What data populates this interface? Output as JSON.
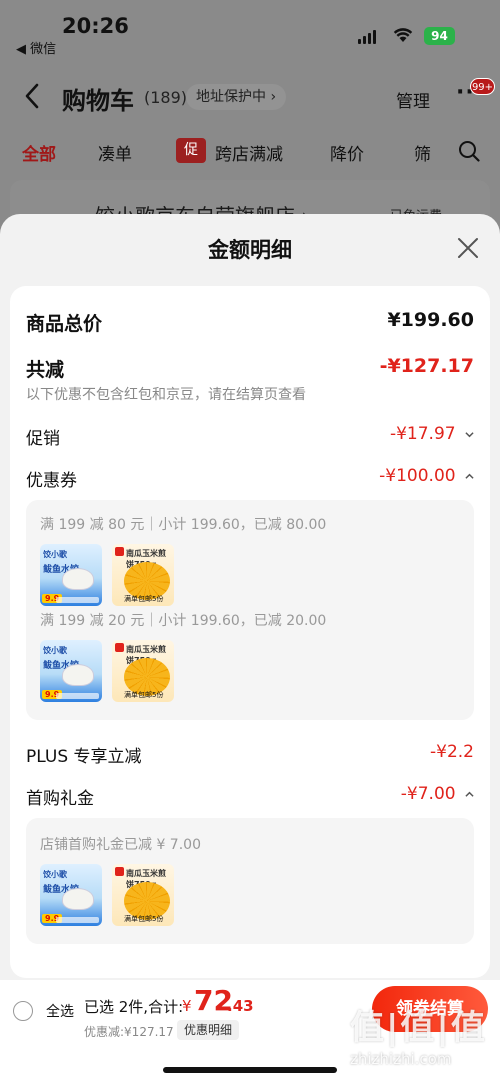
{
  "status": {
    "time": "20:26",
    "back_app": "◀ 微信",
    "battery": "94"
  },
  "nav": {
    "title": "购物车",
    "count": "(189)",
    "address_protect": "地址保护中 ›",
    "manage": "管理",
    "more": "···",
    "badge": "99+"
  },
  "filters": {
    "all": "全部",
    "combine": "凑单",
    "promo_tag": "促",
    "store_discount": "跨店满减",
    "price_drop": "降价",
    "screen": "筛"
  },
  "bg_shop": {
    "name": "饺小歌京东自营旗舰店 ›",
    "fee": "已免运费"
  },
  "sheet": {
    "title": "金额明细",
    "total_label": "商品总价",
    "total_value": "¥199.60",
    "reduce_label": "共减",
    "reduce_value": "-¥127.17",
    "reduce_note": "以下优惠不包含红包和京豆，请在结算页查看",
    "promo_label": "促销",
    "promo_value": "-¥17.97",
    "coupon_label": "优惠券",
    "coupon_value": "-¥100.00",
    "coupon_lines": [
      "满 199 减 80 元｜小计 199.60，已减 80.00",
      "满 199 减 20 元｜小计 199.60，已减 20.00"
    ],
    "plus_label": "PLUS 专享立减",
    "plus_value": "-¥2.2",
    "gift_label": "首购礼金",
    "gift_value": "-¥7.00",
    "gift_line": "店铺首购礼金已减 ¥ 7.00"
  },
  "product_a": {
    "brand": "饺小歌",
    "name": "鲅鱼水饺",
    "tag": "9.9"
  },
  "product_b": {
    "name": "南瓜玉米煎饼750g",
    "foot": "满单包邮5份"
  },
  "bottom": {
    "select_all": "全选",
    "selected": "已选 2件,合计:",
    "currency": "¥",
    "total_int": "72",
    "total_dec": ".43",
    "saved": "优惠减:¥127.17",
    "detail": "优惠明细",
    "checkout": "领券结算"
  },
  "watermark": {
    "logo": "值|值|值",
    "site": "zhizhizhi.com"
  },
  "colors": {
    "accent_red": "#e0231b",
    "battery_green": "#2bb24a"
  }
}
